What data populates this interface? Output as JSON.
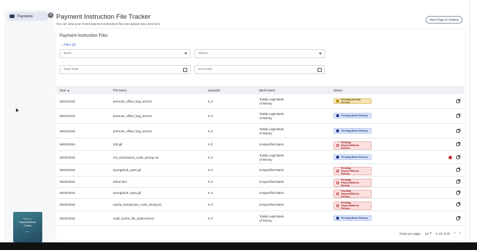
{
  "sidebar": {
    "nav_label": "Payments",
    "collapse_icon": "close-icon",
    "promo_small": "Switch To",
    "promo_line1": "PaymentWorks",
    "promo_line2": "Classic",
    "promo_arrow": "←"
  },
  "header": {
    "title": "Payment Instruction File Tracker",
    "subtitle": "You can view your recent payment instruction files and upload new ones here",
    "view_classic": "View Page in Classic"
  },
  "card": {
    "title": "Payment Instruction Files",
    "filter_label": "⌄ Filter (0)",
    "bank_placeholder": "Bank",
    "status_placeholder": "Status",
    "start_date_placeholder": "Start Date",
    "end_date_placeholder": "End Date"
  },
  "table": {
    "columns": {
      "date": "Date ▲",
      "file": "File Name",
      "uploader": "Uploader",
      "bank": "Bank Name",
      "status": "Status"
    },
    "rows": [
      {
        "date": "06/21/2024",
        "file": "premote_offset_bug_test.txt",
        "uploader": "K Z",
        "bank1": "Totally Legit Bank",
        "bank2": "of Money",
        "status": "Pending Internal Review",
        "kind": "internal",
        "alert": false
      },
      {
        "date": "06/21/2024",
        "file": "premote_offset_bug_test.txt",
        "uploader": "K Z",
        "bank1": "Totally Legit Bank",
        "bank2": "of Money",
        "status": "Pending Bank Delivery",
        "kind": "bank",
        "alert": false
      },
      {
        "date": "06/21/2024",
        "file": "premote_offset_bug_test.txt",
        "uploader": "K Z",
        "bank1": "Totally Legit Bank",
        "bank2": "of Money",
        "status": "Pending Bank Delivery",
        "kind": "bank",
        "alert": false
      },
      {
        "date": "06/20/2024",
        "file": "200.gif",
        "uploader": "K Z",
        "bank1": "Unspecified Bank",
        "bank2": "",
        "status": "Pending PaymentWorks Review",
        "kind": "pm",
        "alert": false
      },
      {
        "date": "06/20/2024",
        "file": "csv_transaction_code_wrong.csv",
        "uploader": "K Z",
        "bank1": "Totally Legit Bank",
        "bank2": "of Money",
        "status": "Pending Bank Delivery",
        "kind": "bank",
        "alert": true
      },
      {
        "date": "06/20/2024",
        "file": "spongebob_eyes.gif",
        "uploader": "K Z",
        "bank1": "Unspecified Bank",
        "bank2": "",
        "status": "Pending PaymentWorks Review",
        "kind": "pm",
        "alert": false
      },
      {
        "date": "06/20/2024",
        "file": "4004.html",
        "uploader": "K Z",
        "bank1": "Unspecified Bank",
        "bank2": "",
        "status": "Pending PaymentWorks Review",
        "kind": "pm",
        "alert": false
      },
      {
        "date": "06/20/2024",
        "file": "spongebob_eyes.gif",
        "uploader": "K Z",
        "bank1": "Unspecified Bank",
        "bank2": "",
        "status": "Pending PaymentWorks Review",
        "kind": "pm",
        "alert": false
      },
      {
        "date": "06/20/2024",
        "file": "nacha_transaction_code_wrong.txt",
        "uploader": "K Z",
        "bank1": "Unspecified Bank",
        "bank2": "",
        "status": "Pending PaymentWorks Review",
        "kind": "pm",
        "alert": false
      },
      {
        "date": "06/20/2024",
        "file": "valid_nacha_file_balanced.txt",
        "uploader": "K Z",
        "bank1": "Totally Legit Bank",
        "bank2": "of Money",
        "status": "Pending Bank Delivery",
        "kind": "bank",
        "alert": false
      }
    ]
  },
  "pagination": {
    "rows_per_page_label": "Rows per page:",
    "rows_per_page_value": "10",
    "range": "1–10 of 30",
    "prev": "‹",
    "next": "›"
  }
}
